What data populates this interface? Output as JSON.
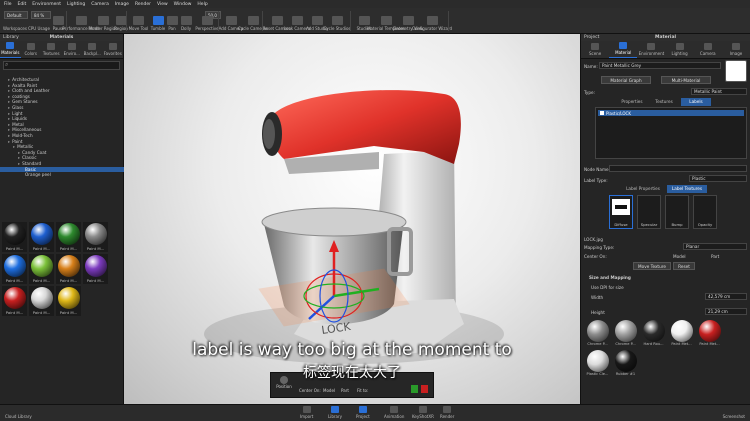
{
  "menu": [
    "File",
    "Edit",
    "Environment",
    "Lighting",
    "Camera",
    "Image",
    "Render",
    "View",
    "Window",
    "Help"
  ],
  "toolbar": {
    "workspace_select": "Default",
    "zoom_select": "84 %",
    "value_field": "50,0",
    "items": [
      {
        "name": "workspaces",
        "label": "Workspaces",
        "active": false
      },
      {
        "name": "cpu-usage",
        "label": "CPU Usage",
        "active": false
      },
      {
        "name": "pause",
        "label": "Pause",
        "active": false
      },
      {
        "name": "performance-mode",
        "label": "Performance Mode",
        "active": false
      },
      {
        "name": "render-region",
        "label": "Render Region",
        "active": false
      },
      {
        "name": "region",
        "label": "Region",
        "active": false
      },
      {
        "name": "move-tool",
        "label": "Move Tool",
        "active": false
      },
      {
        "name": "tumble",
        "label": "Tumble",
        "active": true
      },
      {
        "name": "pan",
        "label": "Pan",
        "active": false
      },
      {
        "name": "dolly",
        "label": "Dolly",
        "active": false
      },
      {
        "name": "perspective",
        "label": "Perspective",
        "active": false
      },
      {
        "name": "add-camera",
        "label": "Add Camera",
        "active": false
      },
      {
        "name": "cycle-cameras",
        "label": "Cycle Cameras",
        "active": false
      },
      {
        "name": "reset-camera",
        "label": "Reset Camera",
        "active": false
      },
      {
        "name": "lock-camera",
        "label": "Lock Camera",
        "active": false
      },
      {
        "name": "add-studio",
        "label": "Add Studio",
        "active": false
      },
      {
        "name": "cycle-studios",
        "label": "Cycle Studios",
        "active": false
      },
      {
        "name": "studios",
        "label": "Studios",
        "active": false
      },
      {
        "name": "material-templates",
        "label": "Material Templates",
        "active": false
      },
      {
        "name": "geometry-view",
        "label": "Geometry View",
        "active": false
      },
      {
        "name": "configurator-wizard",
        "label": "Configurator Wizard",
        "active": false
      }
    ]
  },
  "library": {
    "title": "Library",
    "section": "Materials",
    "tabs": [
      "Materials",
      "Colors",
      "Textures",
      "Enviro...",
      "Backpl...",
      "Favorites"
    ],
    "tree": [
      {
        "label": "Architectural",
        "depth": 1,
        "selected": false
      },
      {
        "label": "Axalta Paint",
        "depth": 1,
        "selected": false
      },
      {
        "label": "Cloth and Leather",
        "depth": 1,
        "selected": false
      },
      {
        "label": "coatings",
        "depth": 1,
        "selected": false
      },
      {
        "label": "Gem Stones",
        "depth": 1,
        "selected": false
      },
      {
        "label": "Glass",
        "depth": 1,
        "selected": false
      },
      {
        "label": "Light",
        "depth": 1,
        "selected": false
      },
      {
        "label": "Liquids",
        "depth": 1,
        "selected": false
      },
      {
        "label": "Metal",
        "depth": 1,
        "selected": false
      },
      {
        "label": "Miscellaneous",
        "depth": 1,
        "selected": false
      },
      {
        "label": "Mold-Tech",
        "depth": 1,
        "selected": false
      },
      {
        "label": "Paint",
        "depth": 1,
        "selected": false
      },
      {
        "label": "Metallic",
        "depth": 2,
        "selected": false
      },
      {
        "label": "Candy Coat",
        "depth": 3,
        "selected": false
      },
      {
        "label": "Classic",
        "depth": 3,
        "selected": false
      },
      {
        "label": "Standard",
        "depth": 3,
        "selected": false
      },
      {
        "label": "Basic",
        "depth": 4,
        "selected": true
      },
      {
        "label": "Orange peel",
        "depth": 4,
        "selected": false
      }
    ],
    "thumbs": [
      {
        "label": "Paint M...",
        "color": "#222"
      },
      {
        "label": "Paint M...",
        "color": "#1e5fd0"
      },
      {
        "label": "Paint M...",
        "color": "#2e8a2e"
      },
      {
        "label": "Paint M...",
        "color": "#8a8a8a"
      },
      {
        "label": "Paint M...",
        "color": "#1e6ee0"
      },
      {
        "label": "Paint M...",
        "color": "#7cc23a"
      },
      {
        "label": "Paint M...",
        "color": "#d8801a"
      },
      {
        "label": "Paint M...",
        "color": "#7d3cc0"
      },
      {
        "label": "Paint M...",
        "color": "#c82020"
      },
      {
        "label": "Paint M...",
        "color": "#d8d8d8"
      },
      {
        "label": "Paint M...",
        "color": "#e0b818"
      }
    ]
  },
  "material": {
    "panel_title": "Project",
    "section": "Material",
    "tabs": [
      "Scene",
      "Material",
      "Environment",
      "Lighting",
      "Camera",
      "Image"
    ],
    "name_label": "Name:",
    "name_value": "Paint Metallic Grey",
    "graph_btn": "Material Graph",
    "multi_btn": "Multi-Material",
    "type_label": "Type:",
    "type_value": "Metallic Paint",
    "subtabs": [
      "Properties",
      "Textures",
      "Labels"
    ],
    "label_item": "Plastic/LOCK",
    "node_name_label": "Node Name:",
    "label_type_label": "Label Type:",
    "label_type_value": "Plastic",
    "lp_tab": "Label Properties",
    "lt_tab": "Label Textures",
    "slots": [
      "Diffuse",
      "Specular",
      "Bump",
      "Opacity"
    ],
    "file_name": "LOCK.jpg",
    "mapping_label": "Mapping Type:",
    "mapping_value": "Planar",
    "center_label": "Center On:",
    "center_model": "Model",
    "center_part": "Part",
    "move_btn": "Move Texture",
    "reset_btn": "Reset",
    "size_section": "Size and Mapping",
    "dpi_label": "Use DPI for size",
    "width_label": "Width",
    "width_value": "42,579 cm",
    "height_label": "Height",
    "height_value": "21,29 cm",
    "swatches": [
      {
        "label": "Chrome P...",
        "color": "#8c8c8c"
      },
      {
        "label": "Chrome P...",
        "color": "#a0a0a0"
      },
      {
        "label": "Hard Rou...",
        "color": "#2a2a2a"
      },
      {
        "label": "Paint Met...",
        "color": "#f0f0f0"
      },
      {
        "label": "Paint Met...",
        "color": "#c82020"
      },
      {
        "label": "Plastic Cle...",
        "color": "#dcdcdc"
      },
      {
        "label": "Rubber #1",
        "color": "#181818"
      }
    ]
  },
  "position_bar": {
    "label": "Position",
    "center_on": "Center On:",
    "model": "Model",
    "part": "Part",
    "fit_to": "Fit to:"
  },
  "subtitle": {
    "en": "label is way too big at the moment to",
    "zh": "标签现在太大了"
  },
  "status": {
    "left": "Cloud Library",
    "right": "Screenshot",
    "tabs": [
      {
        "label": "Import",
        "on": false
      },
      {
        "label": "Library",
        "on": true
      },
      {
        "label": "Project",
        "on": true
      },
      {
        "label": "Animation",
        "on": false
      },
      {
        "label": "KeyShotXR",
        "on": false
      },
      {
        "label": "Render",
        "on": false
      }
    ]
  }
}
